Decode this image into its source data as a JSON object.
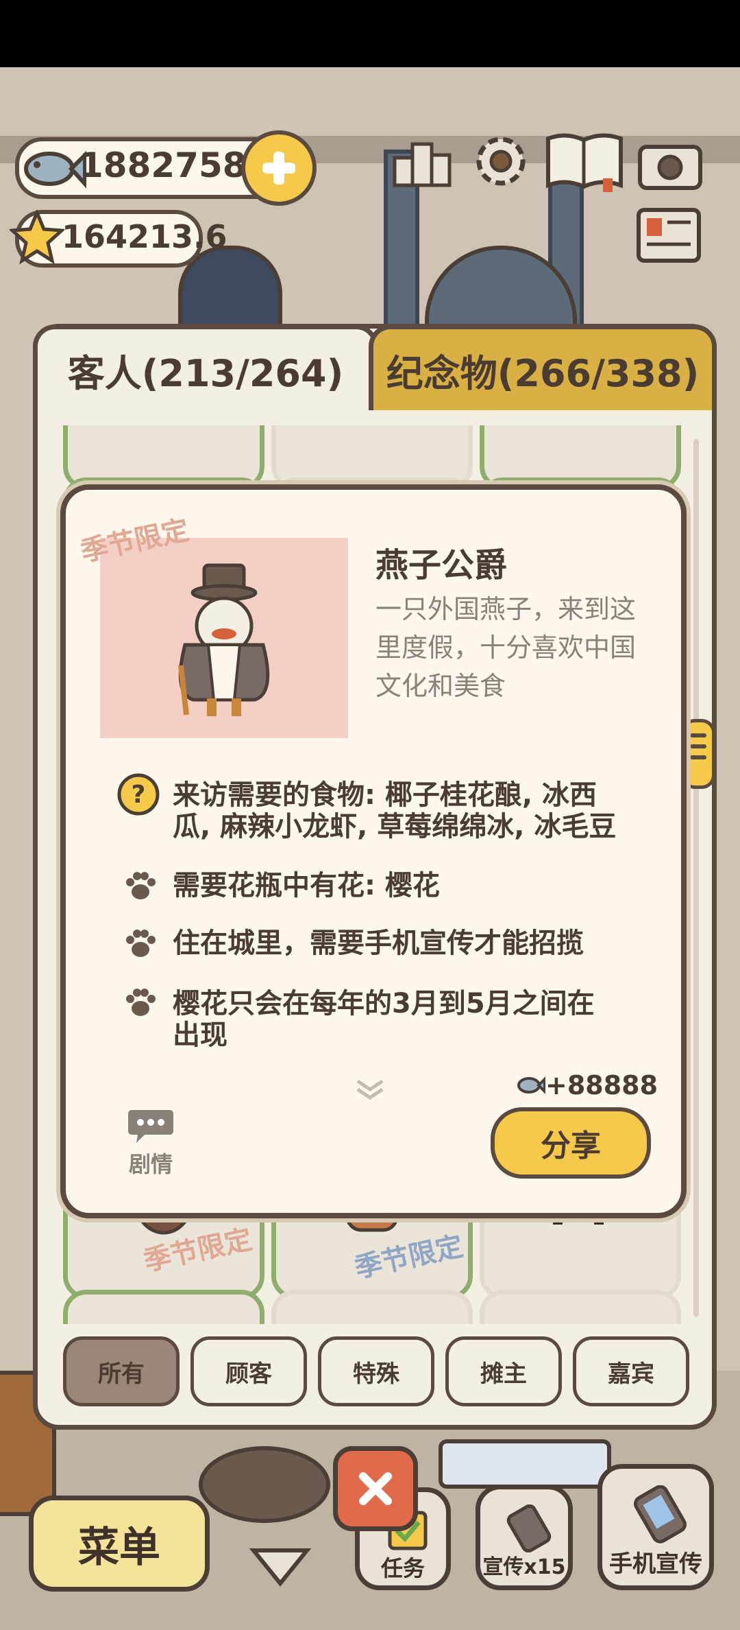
{
  "currency": {
    "fish_amount": "18827580",
    "star_amount": "164213.6"
  },
  "tabs": {
    "guests": "客人(213/264)",
    "souvenirs": "纪念物(266/338)"
  },
  "stamps": {
    "seasonal": "季节限定"
  },
  "guest_detail": {
    "name": "燕子公爵",
    "description_line1": "一只外国燕子，来到这",
    "description_line2": "里度假，十分喜欢中国",
    "description_line3": "文化和美食",
    "food_line1": "来访需要的食物: 椰子桂花酿, 冰西",
    "food_line2": "瓜, 麻辣小龙虾, 草莓绵绵冰, 冰毛豆",
    "flower_req": "需要花瓶中有花: 樱花",
    "city_req": "住在城里，需要手机宣传才能招揽",
    "season_line1": "樱花只会在每年的3月到5月之间在",
    "season_line2": "出现",
    "reward": "+88888",
    "story_label": "剧情",
    "share_label": "分享"
  },
  "filters": [
    "所有",
    "顾客",
    "特殊",
    "摊主",
    "嘉宾"
  ],
  "bottom_bar": {
    "menu": "菜单",
    "tasks": "任务",
    "promote": "宣传x15",
    "phone_promote": "手机宣传"
  },
  "colors": {
    "accent_yellow": "#f6c94a",
    "outline_brown": "#5a4a3f",
    "card_green": "#8fae6e",
    "portrait_pink": "#f4cfc6",
    "close_red": "#e06a4a"
  }
}
